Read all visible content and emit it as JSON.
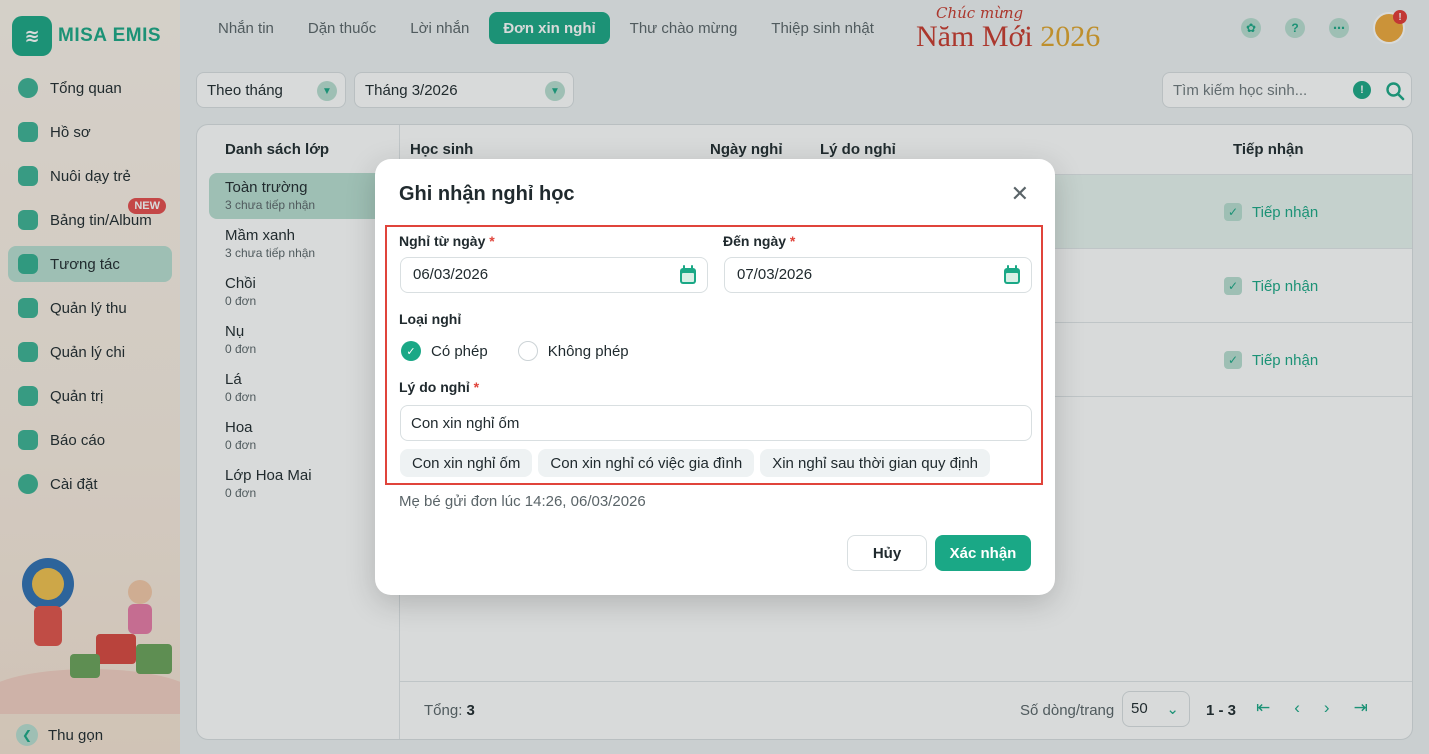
{
  "brand": {
    "logo_text": "MISA EMIS"
  },
  "sidebar": {
    "items": [
      {
        "label": "Tổng quan"
      },
      {
        "label": "Hồ sơ"
      },
      {
        "label": "Nuôi dạy trẻ"
      },
      {
        "label": "Bảng tin/Album",
        "badge": "NEW"
      },
      {
        "label": "Tương tác"
      },
      {
        "label": "Quản lý thu"
      },
      {
        "label": "Quản lý chi"
      },
      {
        "label": "Quản trị"
      },
      {
        "label": "Báo cáo"
      },
      {
        "label": "Cài đặt"
      }
    ],
    "collapse_label": "Thu gọn"
  },
  "topnav": {
    "tabs": [
      {
        "label": "Nhắn tin"
      },
      {
        "label": "Dặn thuốc"
      },
      {
        "label": "Lời nhắn"
      },
      {
        "label": "Đơn xin nghỉ"
      },
      {
        "label": "Thư chào mừng"
      },
      {
        "label": "Thiệp sinh nhật"
      }
    ],
    "banner_small": "Chúc mừng",
    "banner_big": "Năm Mới",
    "banner_year": "2026",
    "avatar_badge": "!"
  },
  "filters": {
    "period_type": "Theo tháng",
    "period_value": "Tháng 3/2026",
    "search_placeholder": "Tìm kiếm học sinh..."
  },
  "class_list": {
    "title": "Danh sách lớp",
    "items": [
      {
        "name": "Toàn trường",
        "sub": "3 chưa tiếp nhận",
        "count": "3"
      },
      {
        "name": "Mầm xanh",
        "sub": "3 chưa tiếp nhận",
        "count": "3"
      },
      {
        "name": "Chồi",
        "sub": "0 đơn"
      },
      {
        "name": "Nụ",
        "sub": "0 đơn"
      },
      {
        "name": "Lá",
        "sub": "0 đơn"
      },
      {
        "name": "Hoa",
        "sub": "0 đơn"
      },
      {
        "name": "Lớp Hoa Mai",
        "sub": "0 đơn"
      }
    ]
  },
  "table": {
    "headers": {
      "student": "Học sinh",
      "date": "Ngày nghỉ",
      "reason": "Lý do nghỉ",
      "accept": "Tiếp nhận"
    },
    "rows": [
      {
        "accept": "Tiếp nhận"
      },
      {
        "accept": "Tiếp nhận"
      },
      {
        "accept": "Tiếp nhận"
      }
    ]
  },
  "footer": {
    "total_label": "Tổng:",
    "total_value": "3",
    "rows_per_page_label": "Số dòng/trang",
    "rows_per_page": "50",
    "range": "1 - 3"
  },
  "modal": {
    "title": "Ghi nhận nghỉ học",
    "from_label": "Nghỉ từ ngày",
    "from_value": "06/03/2026",
    "to_label": "Đến ngày",
    "to_value": "07/03/2026",
    "required_mark": "*",
    "type_label": "Loại nghỉ",
    "type_options": [
      {
        "label": "Có phép",
        "selected": true
      },
      {
        "label": "Không phép",
        "selected": false
      }
    ],
    "reason_label": "Lý do nghỉ",
    "reason_value": "Con xin nghỉ ốm",
    "suggestions": [
      "Con xin nghỉ ốm",
      "Con xin nghỉ có việc gia đình",
      "Xin nghỉ sau thời gian quy định"
    ],
    "sent_note": "Mẹ bé gửi đơn lúc 14:26, 06/03/2026",
    "cancel_label": "Hủy",
    "confirm_label": "Xác nhận"
  },
  "colors": {
    "accent": "#1aa886",
    "accent_light": "#b9ded1",
    "highlight_border": "#e0443b",
    "row_highlight": "#e8f5ef"
  }
}
